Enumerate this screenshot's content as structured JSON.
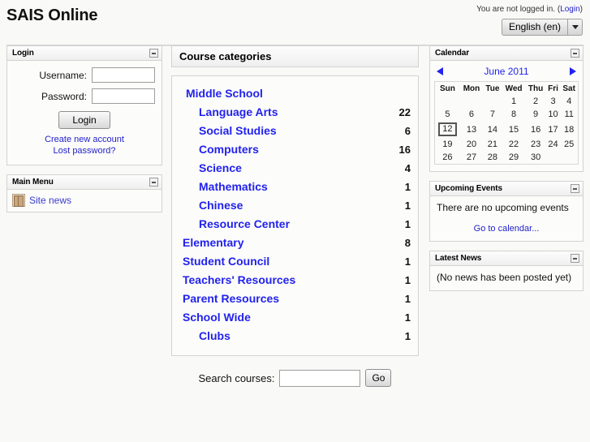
{
  "header": {
    "site_title": "SAIS Online",
    "login_info_text": "You are not logged in. (",
    "login_link": "Login",
    "login_info_close": ")",
    "language_selected": "English (en)",
    "lang_caret_icon": "chevron-down-icon"
  },
  "login_block": {
    "title": "Login",
    "hide_icon": "minimize-icon",
    "username_label": "Username:",
    "username_value": "",
    "password_label": "Password:",
    "password_value": "",
    "login_button": "Login",
    "create_account_link": "Create new account",
    "lost_password_link": "Lost password?"
  },
  "main_menu_block": {
    "title": "Main Menu",
    "hide_icon": "minimize-icon",
    "items": [
      {
        "label": "Site news",
        "icon": "forum-icon"
      }
    ]
  },
  "categories": {
    "header_title": "Course categories",
    "rows": [
      {
        "name": "Middle School",
        "count": "",
        "depth": 0
      },
      {
        "name": "Language Arts",
        "count": "22",
        "depth": 1
      },
      {
        "name": "Social Studies",
        "count": "6",
        "depth": 1
      },
      {
        "name": "Computers",
        "count": "16",
        "depth": 1
      },
      {
        "name": "Science",
        "count": "4",
        "depth": 1
      },
      {
        "name": "Mathematics",
        "count": "1",
        "depth": 1
      },
      {
        "name": "Chinese",
        "count": "1",
        "depth": 1
      },
      {
        "name": "Resource Center",
        "count": "1",
        "depth": 1
      },
      {
        "name": "Elementary",
        "count": "8",
        "depth": 0
      },
      {
        "name": "Student Council",
        "count": "1",
        "depth": 0
      },
      {
        "name": "Teachers' Resources",
        "count": "1",
        "depth": 0
      },
      {
        "name": "Parent Resources",
        "count": "1",
        "depth": 0
      },
      {
        "name": "School Wide",
        "count": "1",
        "depth": 0
      },
      {
        "name": "Clubs",
        "count": "1",
        "depth": 1
      }
    ]
  },
  "search_courses": {
    "label": "Search courses:",
    "value": "",
    "placeholder": "",
    "button": "Go"
  },
  "calendar_block": {
    "title": "Calendar",
    "hide_icon": "minimize-icon",
    "prev_icon": "arrow-left-icon",
    "next_icon": "arrow-right-icon",
    "month_label": "June 2011",
    "weekdays": [
      "Sun",
      "Mon",
      "Tue",
      "Wed",
      "Thu",
      "Fri",
      "Sat"
    ],
    "today": "12",
    "weeks": [
      [
        "",
        "",
        "",
        "1",
        "2",
        "3",
        "4"
      ],
      [
        "5",
        "6",
        "7",
        "8",
        "9",
        "10",
        "11"
      ],
      [
        "12",
        "13",
        "14",
        "15",
        "16",
        "17",
        "18"
      ],
      [
        "19",
        "20",
        "21",
        "22",
        "23",
        "24",
        "25"
      ],
      [
        "26",
        "27",
        "28",
        "29",
        "30",
        "",
        ""
      ]
    ]
  },
  "events_block": {
    "title": "Upcoming Events",
    "hide_icon": "minimize-icon",
    "empty_text": "There are no upcoming events",
    "calendar_link": "Go to calendar..."
  },
  "news_block": {
    "title": "Latest News",
    "hide_icon": "minimize-icon",
    "empty_text": "(No news has been posted yet)"
  },
  "colors": {
    "link": "#2222cc",
    "category_link": "#2222ee",
    "weekend": "#cc0000",
    "page_bg": "#f9f9f7",
    "block_border": "#d3d3d3"
  }
}
